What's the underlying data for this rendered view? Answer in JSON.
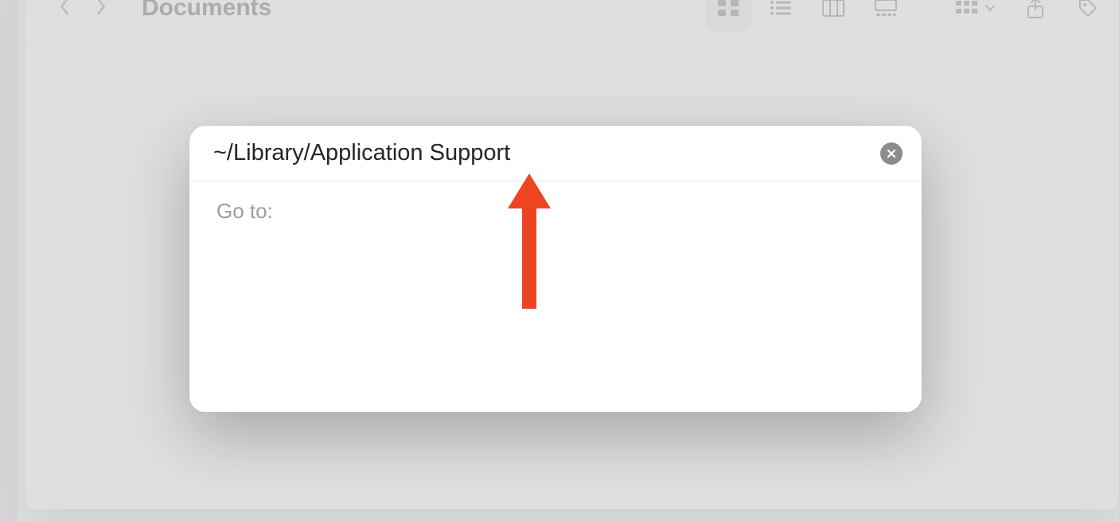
{
  "finder": {
    "title": "Documents"
  },
  "goto": {
    "input_value": "~/Library/Application Support",
    "label": "Go to:"
  },
  "colors": {
    "annotation_arrow": "#ee4422"
  }
}
